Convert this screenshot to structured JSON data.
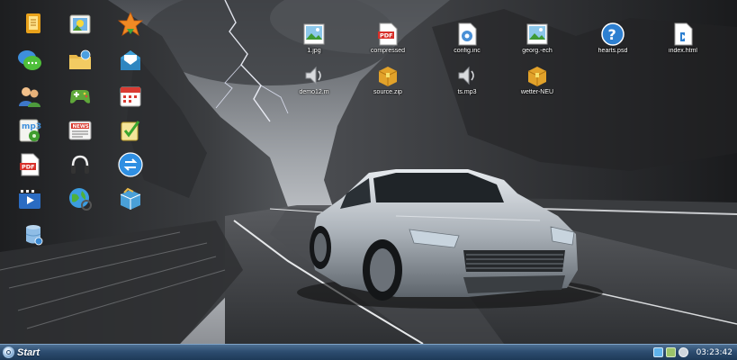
{
  "desktop": {
    "left_icons": [
      {
        "name": "notes-app-icon"
      },
      {
        "name": "photo-viewer-icon"
      },
      {
        "name": "favorites-star-icon"
      },
      {
        "name": "chat-messenger-icon"
      },
      {
        "name": "network-folder-icon"
      },
      {
        "name": "mail-icon"
      },
      {
        "name": "users-contacts-icon"
      },
      {
        "name": "games-controller-icon"
      },
      {
        "name": "calendar-icon"
      },
      {
        "name": "mp3-player-icon"
      },
      {
        "name": "news-reader-icon"
      },
      {
        "name": "task-checklist-icon"
      },
      {
        "name": "pdf-reader-icon"
      },
      {
        "name": "audio-headphones-icon"
      },
      {
        "name": "sync-arrows-icon"
      },
      {
        "name": "video-player-icon"
      },
      {
        "name": "web-browser-icon"
      },
      {
        "name": "package-box-icon"
      },
      {
        "name": "database-icon"
      }
    ],
    "files": [
      {
        "label": "1.jpg",
        "icon": "image-file-icon"
      },
      {
        "label": "compressed",
        "icon": "pdf-file-icon"
      },
      {
        "label": "config.inc",
        "icon": "config-file-icon"
      },
      {
        "label": "georg.-ech",
        "icon": "image-file-icon"
      },
      {
        "label": "hearts.psd",
        "icon": "help-file-icon"
      },
      {
        "label": "index.html",
        "icon": "html-file-icon"
      },
      {
        "label": "demo12.m",
        "icon": "audio-file-icon"
      },
      {
        "label": "source.zip",
        "icon": "zip-archive-icon"
      },
      {
        "label": "ts.mp3",
        "icon": "audio-file-icon"
      },
      {
        "label": "wetter-NEU",
        "icon": "zip-archive-icon"
      }
    ]
  },
  "taskbar": {
    "start_label": "Start",
    "clock": "03:23:42",
    "tray_icons": [
      "network-tray-icon",
      "display-tray-icon",
      "volume-tray-icon"
    ]
  },
  "colors": {
    "taskbar": "#2d4d70",
    "accent": "#7fa3c6"
  }
}
